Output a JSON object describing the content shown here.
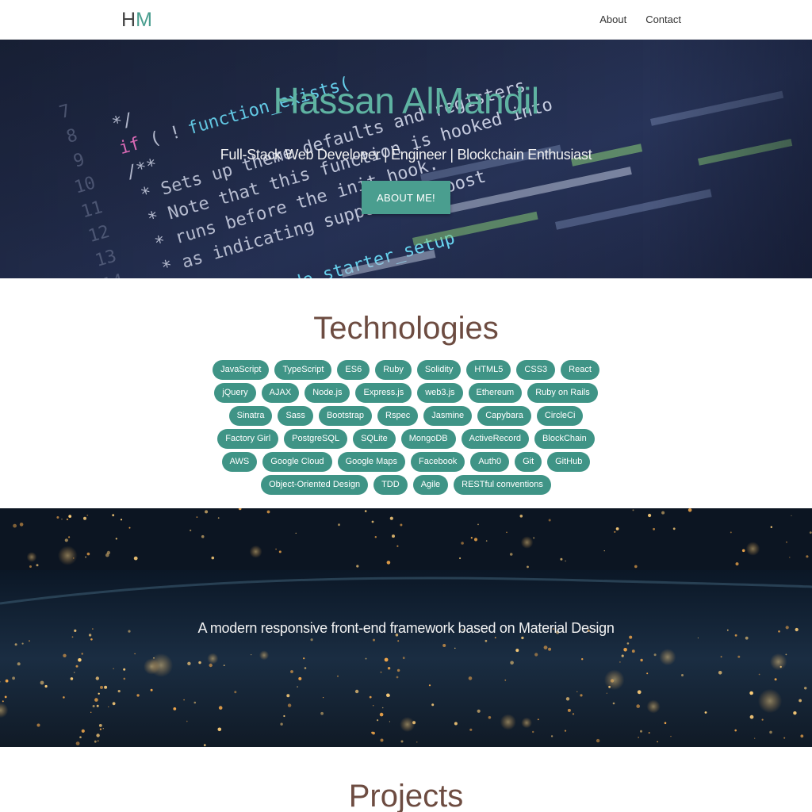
{
  "nav": {
    "logo_h": "H",
    "logo_m": "M",
    "links": [
      {
        "label": "About"
      },
      {
        "label": "Contact"
      }
    ]
  },
  "hero": {
    "title": "Hassan AlMandil",
    "subtitle": "Full-Stack Web Developer | Engineer | Blockchain Enthusiast",
    "button_label": "ABOUT ME!"
  },
  "technologies": {
    "title": "Technologies",
    "rows": [
      [
        "JavaScript",
        "TypeScript",
        "ES6",
        "Ruby",
        "Solidity",
        "HTML5",
        "CSS3",
        "React"
      ],
      [
        "jQuery",
        "AJAX",
        "Node.js",
        "Express.js",
        "web3.js",
        "Ethereum",
        "Ruby on Rails"
      ],
      [
        "Sinatra",
        "Sass",
        "Bootstrap",
        "Rspec",
        "Jasmine",
        "Capybara",
        "CircleCi"
      ],
      [
        "Factory Girl",
        "PostgreSQL",
        "SQLite",
        "MongoDB",
        "ActiveRecord",
        "BlockChain"
      ],
      [
        "AWS",
        "Google Cloud",
        "Google Maps",
        "Facebook",
        "Auth0",
        "Git",
        "GitHub"
      ],
      [
        "Object-Oriented Design",
        "TDD",
        "Agile",
        "RESTful conventions"
      ]
    ]
  },
  "parallax": {
    "text": "A modern responsive front-end framework based on Material Design"
  },
  "projects": {
    "title": "Projects"
  },
  "colors": {
    "accent": "#4a9e8f",
    "heading_brown": "#6d4c41"
  }
}
